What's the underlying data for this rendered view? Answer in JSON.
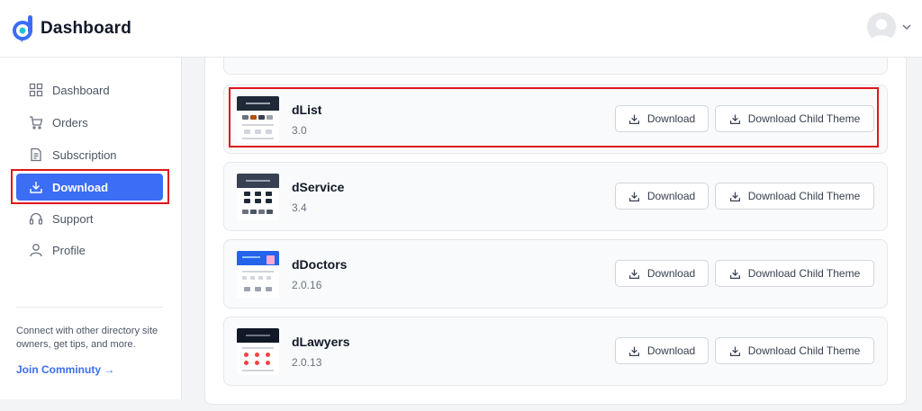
{
  "header": {
    "title": "Dashboard"
  },
  "sidebar": {
    "items": [
      {
        "label": "Dashboard",
        "icon": "grid-icon",
        "active": false
      },
      {
        "label": "Orders",
        "icon": "cart-icon",
        "active": false
      },
      {
        "label": "Subscription",
        "icon": "document-icon",
        "active": false
      },
      {
        "label": "Download",
        "icon": "download-icon",
        "active": true
      },
      {
        "label": "Support",
        "icon": "headset-icon",
        "active": false
      },
      {
        "label": "Profile",
        "icon": "user-icon",
        "active": false
      }
    ],
    "note": "Connect with other directory site owners, get tips, and more.",
    "link": "Join Comminuty →"
  },
  "downloads": [
    {
      "name": "dList",
      "version": "3.0",
      "theme_color": "#1f2937"
    },
    {
      "name": "dService",
      "version": "3.4",
      "theme_color": "#374151"
    },
    {
      "name": "dDoctors",
      "version": "2.0.16",
      "theme_color": "#2563eb"
    },
    {
      "name": "dLawyers",
      "version": "2.0.13",
      "theme_color": "#111827"
    }
  ],
  "buttons": {
    "download": "Download",
    "download_child": "Download Child Theme"
  },
  "colors": {
    "accent": "#3b6df5",
    "highlight": "#e0161c"
  }
}
